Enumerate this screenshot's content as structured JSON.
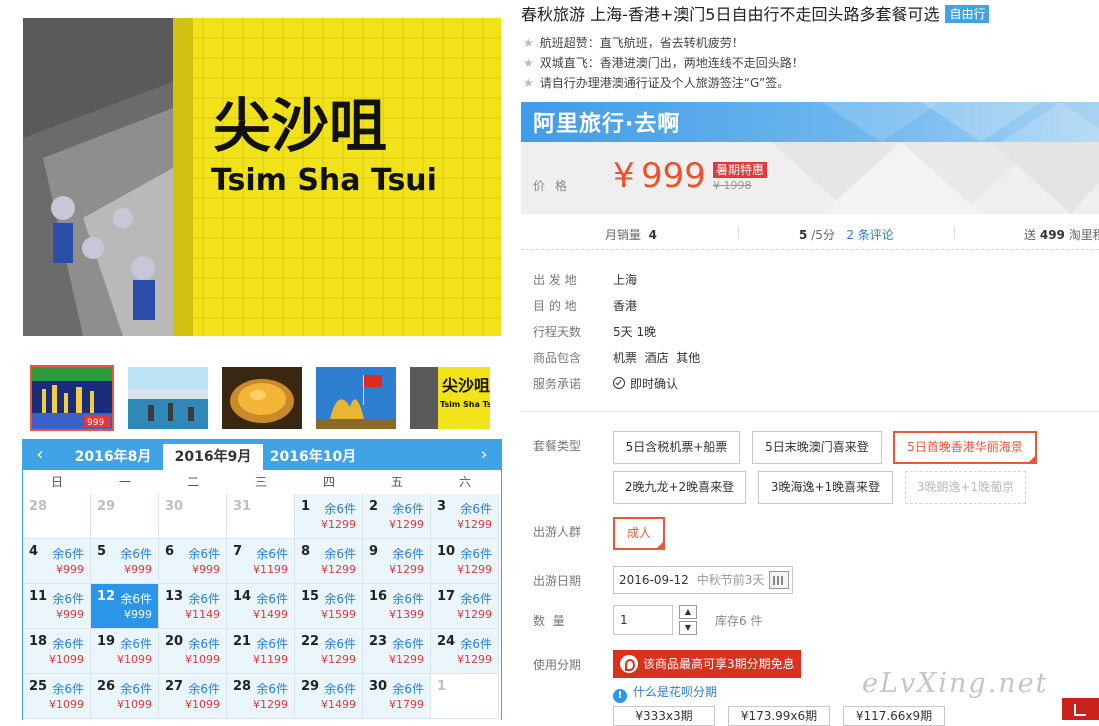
{
  "product": {
    "title": "春秋旅游 上海-香港+澳门5日自由行不走回头路多套餐可选",
    "tag": "自由行",
    "features": [
      "航班超赞：直飞航班，省去转机疲劳！",
      "双城直飞：香港进澳门出，两地连线不走回头路！",
      "请自行办理港澳通行证及个人旅游签注“G”签。"
    ]
  },
  "gallery": {
    "main_photo_text_cn": "尖沙咀",
    "main_photo_text_en": "Tsim Sha Tsui",
    "thumb_badge": "999",
    "thumb_text_en": "Tsim Sha Tsui",
    "thumb_text_cn": "尖沙咀"
  },
  "calendar": {
    "months": [
      "2016年8月",
      "2016年9月",
      "2016年10月"
    ],
    "active_month": "2016年9月",
    "weekdays": [
      "日",
      "一",
      "二",
      "三",
      "四",
      "五",
      "六"
    ],
    "weeks": [
      [
        {
          "d": "28",
          "off": true
        },
        {
          "d": "29",
          "off": true
        },
        {
          "d": "30",
          "off": true
        },
        {
          "d": "31",
          "off": true
        },
        {
          "d": "1",
          "s": "余6件",
          "p": "¥1299"
        },
        {
          "d": "2",
          "s": "余6件",
          "p": "¥1299"
        },
        {
          "d": "3",
          "s": "余6件",
          "p": "¥1299"
        }
      ],
      [
        {
          "d": "4",
          "s": "余6件",
          "p": "¥999"
        },
        {
          "d": "5",
          "s": "余6件",
          "p": "¥999"
        },
        {
          "d": "6",
          "s": "余6件",
          "p": "¥999"
        },
        {
          "d": "7",
          "s": "余6件",
          "p": "¥1199"
        },
        {
          "d": "8",
          "s": "余6件",
          "p": "¥1299"
        },
        {
          "d": "9",
          "s": "余6件",
          "p": "¥1299"
        },
        {
          "d": "10",
          "s": "余6件",
          "p": "¥1299"
        }
      ],
      [
        {
          "d": "11",
          "s": "余6件",
          "p": "¥999"
        },
        {
          "d": "12",
          "s": "余6件",
          "p": "¥999",
          "today": true
        },
        {
          "d": "13",
          "s": "余6件",
          "p": "¥1149"
        },
        {
          "d": "14",
          "s": "余6件",
          "p": "¥1499"
        },
        {
          "d": "15",
          "s": "余6件",
          "p": "¥1599"
        },
        {
          "d": "16",
          "s": "余6件",
          "p": "¥1399"
        },
        {
          "d": "17",
          "s": "余6件",
          "p": "¥1299"
        }
      ],
      [
        {
          "d": "18",
          "s": "余6件",
          "p": "¥1099"
        },
        {
          "d": "19",
          "s": "余6件",
          "p": "¥1099"
        },
        {
          "d": "20",
          "s": "余6件",
          "p": "¥1099"
        },
        {
          "d": "21",
          "s": "余6件",
          "p": "¥1199"
        },
        {
          "d": "22",
          "s": "余6件",
          "p": "¥1299"
        },
        {
          "d": "23",
          "s": "余6件",
          "p": "¥1299"
        },
        {
          "d": "24",
          "s": "余6件",
          "p": "¥1299"
        }
      ],
      [
        {
          "d": "25",
          "s": "余6件",
          "p": "¥1099"
        },
        {
          "d": "26",
          "s": "余6件",
          "p": "¥1099"
        },
        {
          "d": "27",
          "s": "余6件",
          "p": "¥1099"
        },
        {
          "d": "28",
          "s": "余6件",
          "p": "¥1299"
        },
        {
          "d": "29",
          "s": "余6件",
          "p": "¥1499"
        },
        {
          "d": "30",
          "s": "余6件",
          "p": "¥1799"
        },
        {
          "d": "1",
          "off": true
        }
      ]
    ]
  },
  "price": {
    "brand": "阿里旅行·去啊",
    "label": "价格",
    "currency": "¥",
    "value": "999",
    "promo": "暑期特惠",
    "original": "¥ 1998"
  },
  "stats": {
    "sales_label": "月销量",
    "sales_value": "4",
    "rating_value": "5",
    "rating_suffix": "/5分",
    "reviews_link": "2 条评论",
    "points_prefix": "送",
    "points_value": "499",
    "points_suffix": "淘里程"
  },
  "details": [
    {
      "k": "出 发 地",
      "v": "上海"
    },
    {
      "k": "目 的 地",
      "v": "香港"
    },
    {
      "k": "行程天数",
      "v": "5天 1晚"
    },
    {
      "k": "商品包含",
      "v": "机票  酒店  其他"
    },
    {
      "k": "服务承诺",
      "v": "即时确认"
    }
  ],
  "options": {
    "package_label": "套餐类型",
    "packages": [
      "5日含税机票+船票",
      "5日末晚澳门喜来登",
      "5日首晚香港华丽海景",
      "2晚九龙+2晚喜来登",
      "3晚海逸+1晚喜来登",
      "3晚朗逸+1晚葡京"
    ],
    "traveler_label": "出游人群",
    "traveler": "成人",
    "date_label": "出游日期",
    "date_value": "2016-09-12",
    "date_hint": "中秋节前3天",
    "qty_label": "数  量",
    "qty_value": "1",
    "stock": "库存6 件",
    "installment_label": "使用分期",
    "installment_banner": "该商品最高可享3期分期免息",
    "installment_help": "什么是花呗分期",
    "plans": [
      "¥333x3期",
      "¥173.99x6期",
      "¥117.66x9期"
    ]
  },
  "watermark": "eLvXing.net",
  "colors": {
    "accent": "#3fa3e6",
    "price": "#f0512d",
    "selected": "#e8573a",
    "banner": "#d8321e"
  }
}
